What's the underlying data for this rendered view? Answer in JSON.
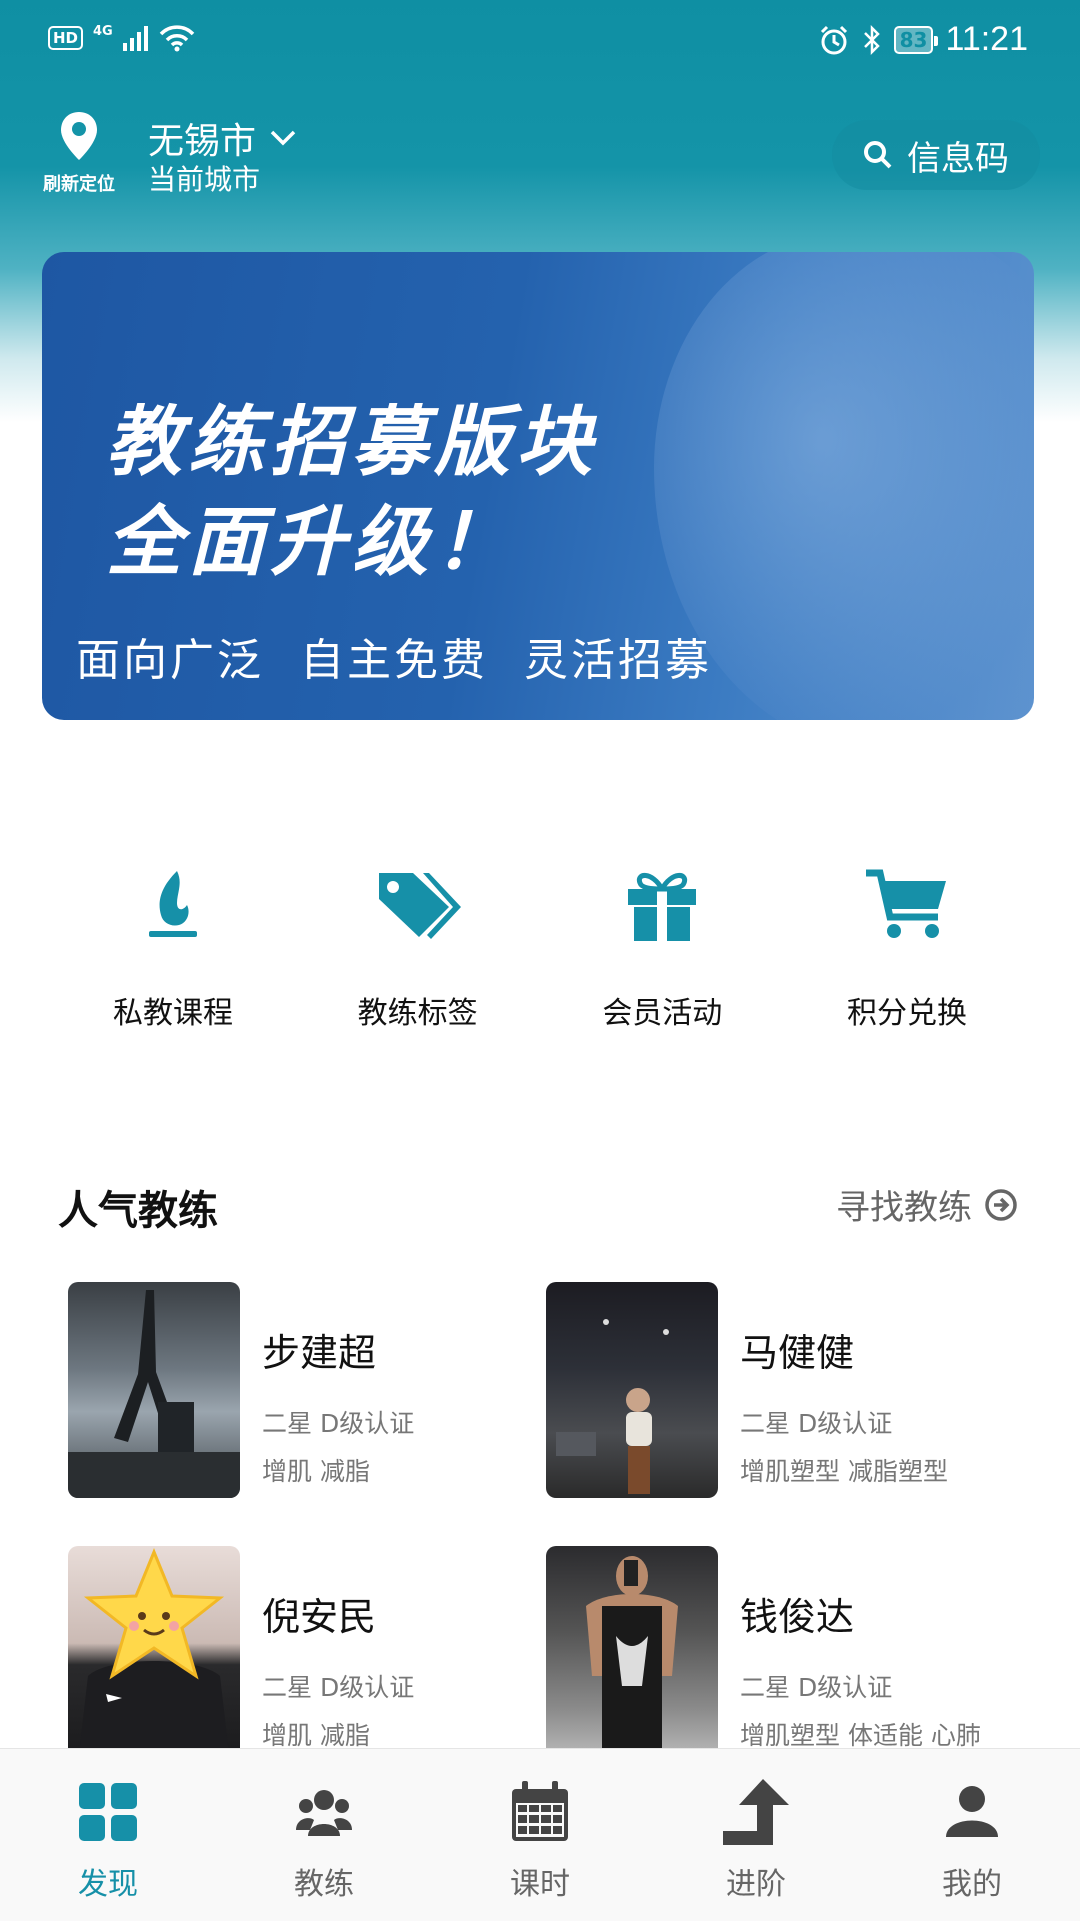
{
  "status_bar": {
    "hd": "HD",
    "network": "4G",
    "battery": "83",
    "time": "11:21"
  },
  "header": {
    "refresh_location": "刷新定位",
    "city": "无锡市",
    "city_caption": "当前城市",
    "info_code": "信息码"
  },
  "banner": {
    "title_line1": "教练招募版块",
    "title_line2": "全面升级！",
    "tags": [
      "面向广泛",
      "自主免费",
      "灵活招募"
    ]
  },
  "quick_actions": [
    {
      "label": "私教课程",
      "icon": "flame-icon"
    },
    {
      "label": "教练标签",
      "icon": "tags-icon"
    },
    {
      "label": "会员活动",
      "icon": "gift-icon"
    },
    {
      "label": "积分兑换",
      "icon": "cart-icon"
    }
  ],
  "popular": {
    "title": "人气教练",
    "more": "寻找教练",
    "coaches": [
      {
        "name": "步建超",
        "level": "二星  D级认证",
        "tags": "增肌 减脂"
      },
      {
        "name": "马健健",
        "level": "二星  D级认证",
        "tags": "增肌塑型 减脂塑型"
      },
      {
        "name": "倪安民",
        "level": "二星  D级认证",
        "tags": "增肌 减脂"
      },
      {
        "name": "钱俊达",
        "level": "二星  D级认证",
        "tags": "增肌塑型 体适能 心肺"
      }
    ]
  },
  "tabbar": {
    "tabs": [
      {
        "label": "发现",
        "icon": "grid-icon",
        "active": true
      },
      {
        "label": "教练",
        "icon": "group-icon",
        "active": false
      },
      {
        "label": "课时",
        "icon": "calendar-icon",
        "active": false
      },
      {
        "label": "进阶",
        "icon": "arrow-up-icon",
        "active": false
      },
      {
        "label": "我的",
        "icon": "user-icon",
        "active": false
      }
    ]
  },
  "colors": {
    "accent": "#1690a8",
    "header_bg": "#0f8fa3",
    "banner_bg": "#2462ae"
  }
}
